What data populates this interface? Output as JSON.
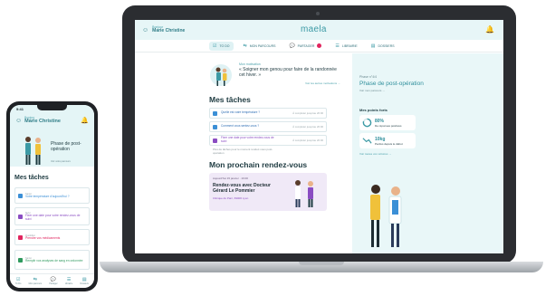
{
  "brand": {
    "primary": "#3c9aa5",
    "accent_purple": "#8a4cc2",
    "accent_blue": "#3b8fd6",
    "badge": "#e0245e"
  },
  "web": {
    "user": {
      "greeting": "Bonjour",
      "name": "Marie Christine",
      "icon": "user-icon"
    },
    "logo": "maela",
    "bell_icon": "bell-icon",
    "nav": [
      {
        "label": "TO DO",
        "icon": "check-icon",
        "active": true
      },
      {
        "label": "MON PARCOURS",
        "icon": "route-icon"
      },
      {
        "label": "PARTAGER",
        "icon": "chat-icon",
        "badge": true
      },
      {
        "label": "LIBRAIRIE",
        "icon": "book-icon"
      },
      {
        "label": "DOSSIERS",
        "icon": "folder-icon"
      }
    ],
    "goal": {
      "label": "Mon motivation",
      "quote": "« Soigner mon genou pour faire de la randonnée cet hiver. »",
      "link": "Voir les autres motivations →"
    },
    "tasks_title": "Mes tâches",
    "tasks": [
      {
        "title": "Quelle est votre température ?",
        "date": "À compléter jusqu'au 20:00",
        "color": "blue"
      },
      {
        "title": "Comment vous sentez-vous ?",
        "date": "À compléter jusqu'au 20:00",
        "color": "blue"
      },
      {
        "title": "Fixer une date pour votre rendez-vous de suivi",
        "date": "À compléter jusqu'au 20:00",
        "color": "purple"
      }
    ],
    "tasks_note": "Plus de tâches pour le moment rendez-vous post-opération",
    "appt_title": "Mon prochain rendez-vous",
    "appt": {
      "date": "Aujourd'hui 15 janvier · 16:00",
      "title": "Rendez-vous avec Docteur Gérard Le Pommier",
      "location": "Clinique du Parc, 69006 Lyon"
    },
    "phase": {
      "label": "Phase n°4/4",
      "title": "Phase de post-opération",
      "sub": "Voir mon parcours →"
    },
    "strengths_title": "Mes points forts",
    "stats": [
      {
        "value": "80%",
        "label": "De réponses positives"
      },
      {
        "value": "10kg",
        "label": "Perdus depuis le début"
      }
    ],
    "strengths_link": "Voir toutes vos victoires →"
  },
  "phone": {
    "time": "9:41",
    "user": {
      "greeting": "Bonjour",
      "name": "Marie Christine"
    },
    "phase": "Phase de post-opération",
    "phase_sub": "Voir votre parcours",
    "tasks_title": "Mes tâches",
    "tasks": [
      {
        "tag": "Santé",
        "title": "Votre température d'aujourd'hui ?",
        "color": "#3b8fd6"
      },
      {
        "tag": "Suivi",
        "title": "Fixer une date pour votre rendez-vous de suivi",
        "color": "#8a4cc2"
      },
      {
        "tag": "Quotidien",
        "title": "Prendre vos médicaments",
        "color": "#e0245e"
      },
      {
        "tag": "Santé",
        "title": "Remplir vos analyses de sang en ordonnée",
        "color": "#2f9a5e"
      }
    ],
    "tabs": [
      {
        "label": "To Do",
        "icon": "check-icon"
      },
      {
        "label": "Mon parcours",
        "icon": "route-icon"
      },
      {
        "label": "Partager",
        "icon": "chat-icon"
      },
      {
        "label": "Librairie",
        "icon": "book-icon"
      },
      {
        "label": "Dossiers",
        "icon": "folder-icon"
      }
    ]
  }
}
